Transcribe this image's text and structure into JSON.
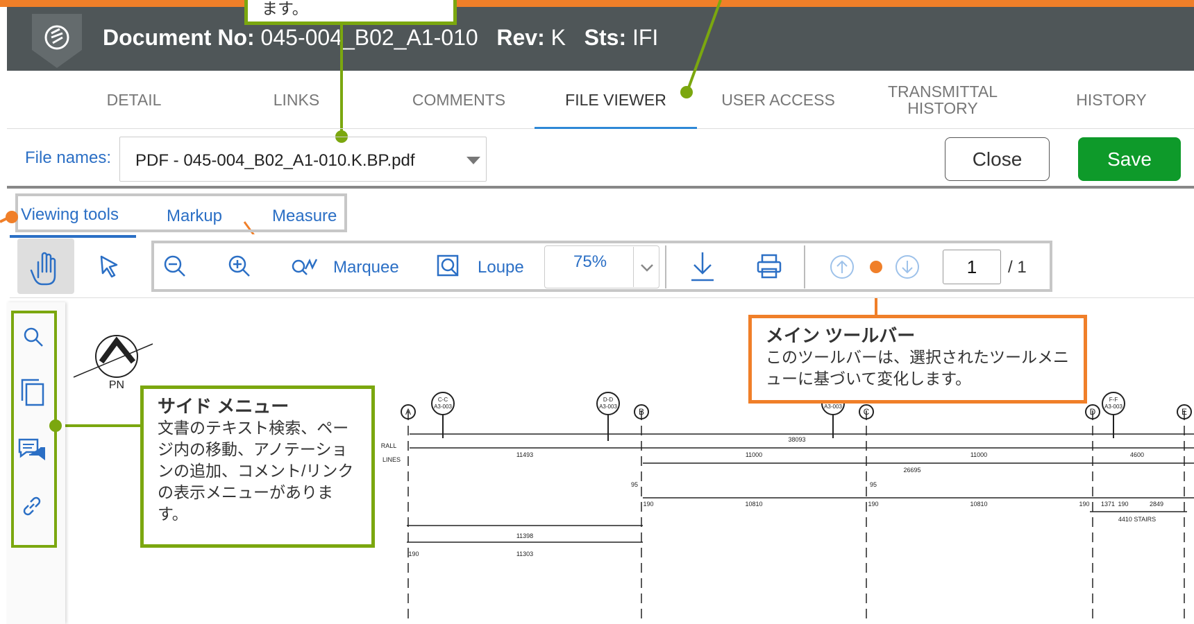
{
  "header": {
    "doc_label": "Document No:",
    "doc_value": "045-004_B02_A1-010",
    "rev_label": "Rev:",
    "rev_value": "K",
    "sts_label": "Sts:",
    "sts_value": "IFI"
  },
  "tabs": [
    "DETAIL",
    "LINKS",
    "COMMENTS",
    "FILE VIEWER",
    "USER ACCESS",
    "TRANSMITTAL HISTORY",
    "HISTORY"
  ],
  "active_tab": "FILE VIEWER",
  "file_row": {
    "label": "File names:",
    "selected_file": "PDF - 045-004_B02_A1-010.K.BP.pdf",
    "close_label": "Close",
    "save_label": "Save"
  },
  "viewer_tabs": [
    "Viewing tools",
    "Markup",
    "Measure"
  ],
  "toolbar": {
    "marquee_label": "Marquee",
    "loupe_label": "Loupe",
    "zoom_value": "75%",
    "page_current": "1",
    "page_total": "/ 1"
  },
  "icons": {
    "hand": "hand-pan-icon",
    "select": "pointer-icon",
    "zoom_out": "zoom-out-icon",
    "zoom_in": "zoom-in-icon",
    "marquee": "marquee-icon",
    "loupe": "loupe-icon",
    "download": "download-icon",
    "print": "print-icon",
    "prev_page": "arrow-up-circle-icon",
    "next_page": "arrow-down-circle-icon",
    "side_search": "search-icon",
    "side_pages": "pages-icon",
    "side_comments": "comments-icon",
    "side_links": "link-icon"
  },
  "callouts": {
    "top_fragment": "ます。",
    "main_toolbar_title": "メイン ツールバー",
    "main_toolbar_body": "このツールバーは、選択されたツールメニューに基づいて変化します。",
    "side_menu_title": "サイド メニュー",
    "side_menu_body": "文書のテキスト検索、ページ内の移動、アノテーションの追加、コメント/リンクの表示メニューがあります。"
  },
  "drawing": {
    "north_label": "PN",
    "grid": [
      "A",
      "B",
      "C",
      "D",
      "E"
    ],
    "sections": [
      "C-C",
      "D-D",
      "F-F"
    ],
    "section_ref": "A3-003",
    "row_labels": [
      "RALL",
      "LINES"
    ],
    "dims": [
      "38093",
      "11493",
      "11000",
      "11000",
      "4600",
      "26695",
      "95",
      "95",
      "190",
      "10810",
      "190",
      "10810",
      "190",
      "1371",
      "190",
      "2849",
      "4410 STAIRS",
      "11398",
      "190",
      "11303"
    ]
  },
  "colors": {
    "accent_orange": "#f07f29",
    "callout_green": "#7ba70f",
    "header_bg": "#4f5658",
    "save_green": "#0e9a2a",
    "link_blue": "#2b6fc5"
  }
}
